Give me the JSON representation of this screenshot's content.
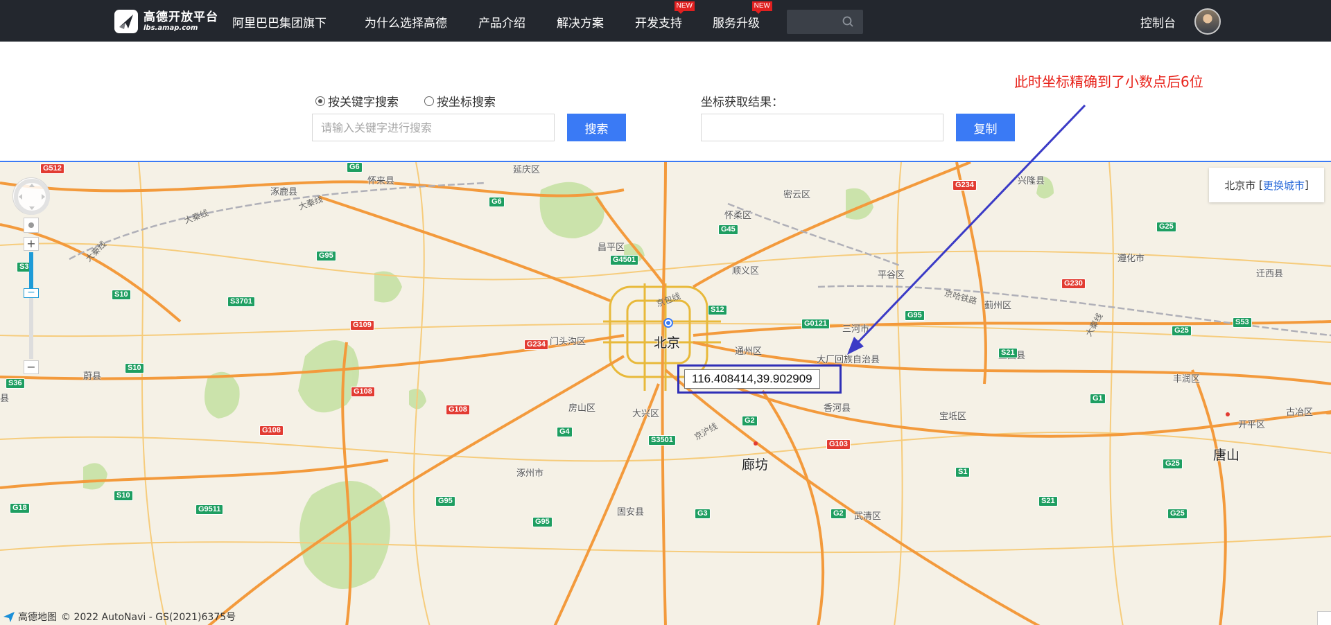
{
  "header": {
    "logo_title": "高德开放平台",
    "logo_sub": "lbs.amap.com",
    "brand_tag": "阿里巴巴集团旗下",
    "nav": [
      {
        "label": "为什么选择高德",
        "badge": ""
      },
      {
        "label": "产品介绍",
        "badge": ""
      },
      {
        "label": "解决方案",
        "badge": ""
      },
      {
        "label": "开发支持",
        "badge": "NEW"
      },
      {
        "label": "服务升级",
        "badge": "NEW"
      }
    ],
    "console": "控制台",
    "search_icon": "search-icon"
  },
  "form": {
    "radio_keyword": "按关键字搜索",
    "radio_coord": "按坐标搜索",
    "selected": "keyword",
    "keyword_placeholder": "请输入关键字进行搜索",
    "search_button": "搜索",
    "result_label": "坐标获取结果：",
    "result_value": "",
    "copy_button": "复制"
  },
  "annotation": "此时坐标精确到了小数点后6位",
  "map": {
    "city": "北京市",
    "change_city": "更换城市",
    "coordinate": "116.408414,39.902909",
    "zoom_level_fraction": 0.62,
    "copyright_logo": "高德地图",
    "copyright": "© 2022 AutoNavi - GS(2021)6375号",
    "places": [
      {
        "name": "涿鹿县",
        "size": "s"
      },
      {
        "name": "怀来县",
        "size": "s"
      },
      {
        "name": "延庆区",
        "size": "s"
      },
      {
        "name": "密云区",
        "size": "s"
      },
      {
        "name": "兴隆县",
        "size": "s"
      },
      {
        "name": "怀柔区",
        "size": "s"
      },
      {
        "name": "昌平区",
        "size": "s"
      },
      {
        "name": "顺义区",
        "size": "s"
      },
      {
        "name": "平谷区",
        "size": "s"
      },
      {
        "name": "遵化市",
        "size": "s"
      },
      {
        "name": "迁西县",
        "size": "s"
      },
      {
        "name": "蓟州区",
        "size": "s"
      },
      {
        "name": "门头沟区",
        "size": "s"
      },
      {
        "name": "北京",
        "size": "l"
      },
      {
        "name": "通州区",
        "size": "s"
      },
      {
        "name": "三河市",
        "size": "s"
      },
      {
        "name": "大厂回族自治县",
        "size": "s"
      },
      {
        "name": "玉田县",
        "size": "s"
      },
      {
        "name": "丰润区",
        "size": "s"
      },
      {
        "name": "古冶区",
        "size": "s"
      },
      {
        "name": "蔚县",
        "size": "s"
      },
      {
        "name": "房山区",
        "size": "s"
      },
      {
        "name": "大兴区",
        "size": "s"
      },
      {
        "name": "香河县",
        "size": "s"
      },
      {
        "name": "宝坻区",
        "size": "s"
      },
      {
        "name": "开平区",
        "size": "s"
      },
      {
        "name": "唐山",
        "size": "l"
      },
      {
        "name": "涿州市",
        "size": "s"
      },
      {
        "name": "廊坊",
        "size": "l"
      },
      {
        "name": "固安县",
        "size": "s"
      },
      {
        "name": "武清区",
        "size": "s"
      },
      {
        "name": "县",
        "size": "s"
      }
    ],
    "rail_labels": [
      "大秦线",
      "大秦线",
      "大秦线",
      "京包线",
      "京沪线",
      "京哈铁路",
      "大秦线"
    ],
    "shields": [
      {
        "code": "G512",
        "color": "red"
      },
      {
        "code": "G6",
        "color": "green"
      },
      {
        "code": "G6",
        "color": "green"
      },
      {
        "code": "G234",
        "color": "red"
      },
      {
        "code": "G25",
        "color": "green"
      },
      {
        "code": "G45",
        "color": "green"
      },
      {
        "code": "G95",
        "color": "green"
      },
      {
        "code": "G4501",
        "color": "green"
      },
      {
        "code": "S10",
        "color": "green"
      },
      {
        "code": "S3701",
        "color": "green"
      },
      {
        "code": "G109",
        "color": "red"
      },
      {
        "code": "S12",
        "color": "green"
      },
      {
        "code": "G0121",
        "color": "green"
      },
      {
        "code": "G95",
        "color": "green"
      },
      {
        "code": "G230",
        "color": "red"
      },
      {
        "code": "G25",
        "color": "green"
      },
      {
        "code": "S53",
        "color": "green"
      },
      {
        "code": "G234",
        "color": "red"
      },
      {
        "code": "S21",
        "color": "green"
      },
      {
        "code": "S10",
        "color": "green"
      },
      {
        "code": "S36",
        "color": "green"
      },
      {
        "code": "G108",
        "color": "red"
      },
      {
        "code": "G108",
        "color": "red"
      },
      {
        "code": "G1",
        "color": "green"
      },
      {
        "code": "G2",
        "color": "green"
      },
      {
        "code": "G4",
        "color": "green"
      },
      {
        "code": "S3501",
        "color": "green"
      },
      {
        "code": "G103",
        "color": "red"
      },
      {
        "code": "S1",
        "color": "green"
      },
      {
        "code": "G108",
        "color": "red"
      },
      {
        "code": "G25",
        "color": "green"
      },
      {
        "code": "S10",
        "color": "green"
      },
      {
        "code": "G18",
        "color": "green"
      },
      {
        "code": "G9511",
        "color": "green"
      },
      {
        "code": "G95",
        "color": "green"
      },
      {
        "code": "G3",
        "color": "green"
      },
      {
        "code": "G2",
        "color": "green"
      },
      {
        "code": "S21",
        "color": "green"
      },
      {
        "code": "G25",
        "color": "green"
      },
      {
        "code": "G95",
        "color": "green"
      },
      {
        "code": "S3",
        "color": "green"
      }
    ],
    "colors": {
      "road_major": "#f39a3c",
      "road_minor": "#f7c977",
      "greenery": "#b9dc8f",
      "shield_red": "#e23b32",
      "shield_green": "#1e9e61",
      "arrow": "#3b3bc6"
    }
  }
}
